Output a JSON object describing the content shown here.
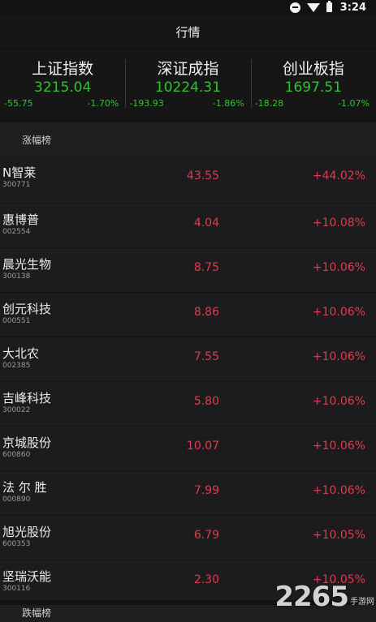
{
  "status": {
    "time": "3:24"
  },
  "header": {
    "title": "行情"
  },
  "indices": [
    {
      "name": "上证指数",
      "value": "3215.04",
      "change": "-55.75",
      "percent": "-1.70%"
    },
    {
      "name": "深证成指",
      "value": "10224.31",
      "change": "-193.93",
      "percent": "-1.86%"
    },
    {
      "name": "创业板指",
      "value": "1697.51",
      "change": "-18.28",
      "percent": "-1.07%"
    }
  ],
  "gainers": {
    "title": "涨幅榜",
    "rows": [
      {
        "name": "N智莱",
        "code": "300771",
        "price": "43.55",
        "change": "+44.02%"
      },
      {
        "name": "惠博普",
        "code": "002554",
        "price": "4.04",
        "change": "+10.08%"
      },
      {
        "name": "晨光生物",
        "code": "300138",
        "price": "8.75",
        "change": "+10.06%"
      },
      {
        "name": "创元科技",
        "code": "000551",
        "price": "8.86",
        "change": "+10.06%"
      },
      {
        "name": "大北农",
        "code": "002385",
        "price": "7.55",
        "change": "+10.06%"
      },
      {
        "name": "吉峰科技",
        "code": "300022",
        "price": "5.80",
        "change": "+10.06%"
      },
      {
        "name": "京城股份",
        "code": "600860",
        "price": "10.07",
        "change": "+10.06%"
      },
      {
        "name": "法 尔 胜",
        "code": "000890",
        "price": "7.99",
        "change": "+10.06%"
      },
      {
        "name": "旭光股份",
        "code": "600353",
        "price": "6.79",
        "change": "+10.05%"
      },
      {
        "name": "坚瑞沃能",
        "code": "300116",
        "price": "2.30",
        "change": "+10.05%"
      }
    ]
  },
  "losers": {
    "title": "跌幅榜"
  },
  "watermark": {
    "logo": "2265",
    "sub": "手游网"
  },
  "colors": {
    "up": "#e03a4e",
    "down": "#2bc42b"
  }
}
